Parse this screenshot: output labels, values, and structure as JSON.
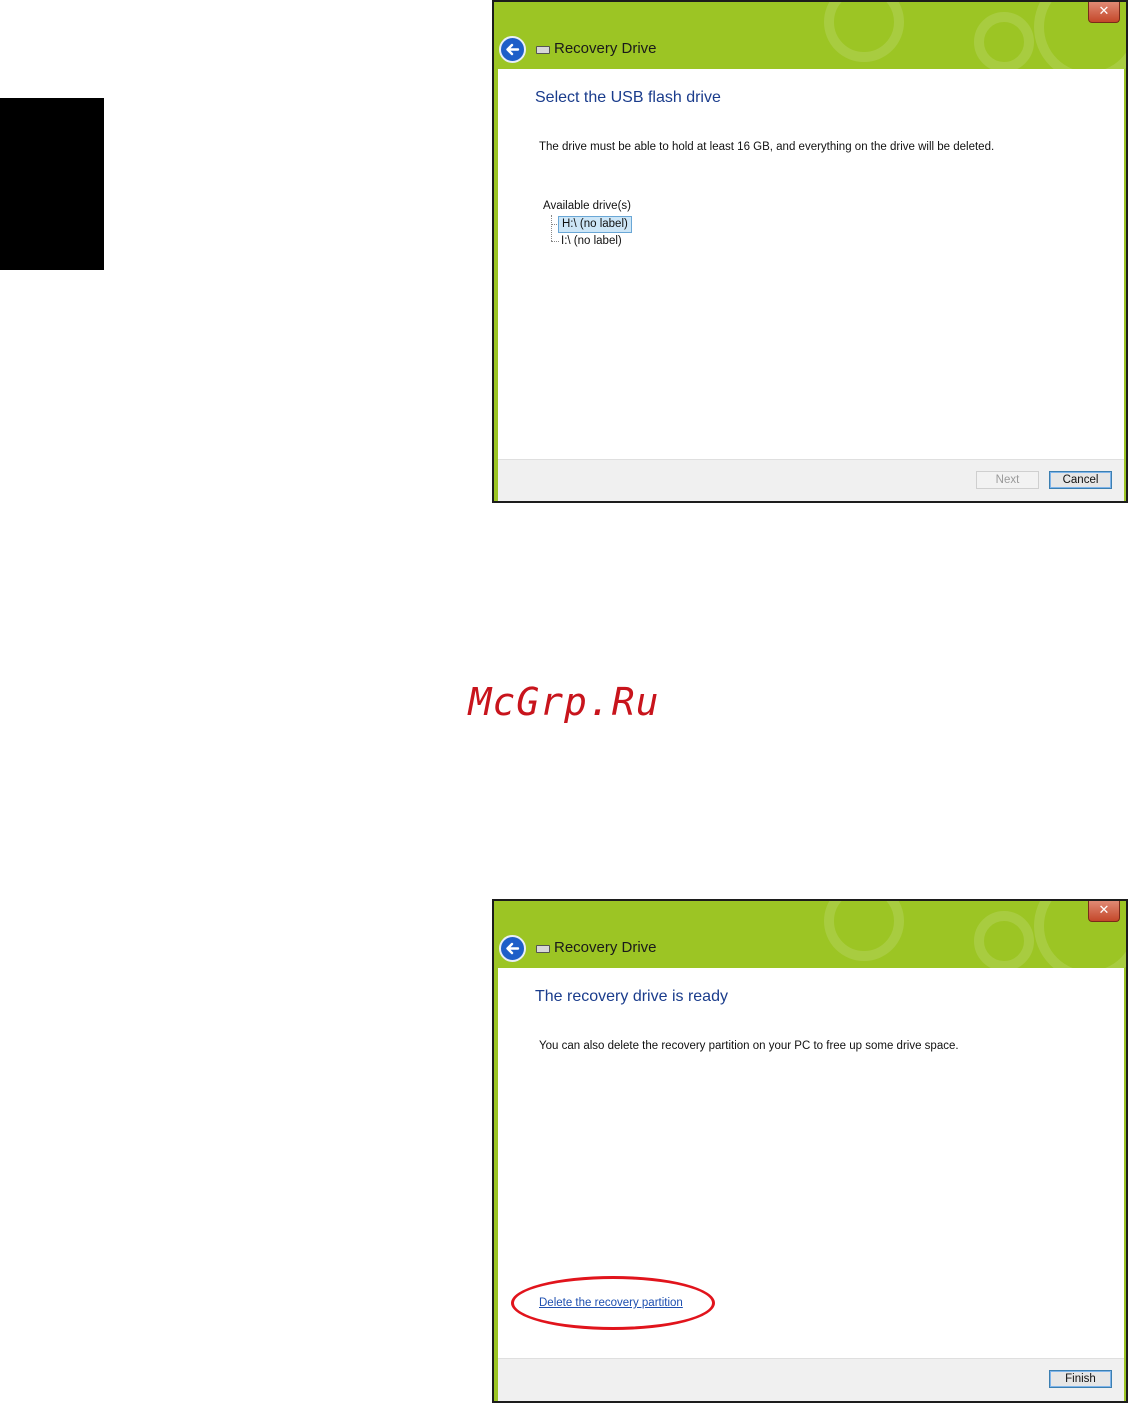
{
  "watermark": "McGrp.Ru",
  "watermark_color": "#c8141c",
  "window1": {
    "title": "Recovery Drive",
    "close": "✕",
    "heading": "Select the USB flash drive",
    "description": "The drive must be able to hold at least 16 GB, and everything on the drive will be deleted.",
    "tree_label": "Available drive(s)",
    "drives": [
      {
        "label": "H:\\ (no label)",
        "selected": true
      },
      {
        "label": "I:\\ (no label)",
        "selected": false
      }
    ],
    "next_label": "Next",
    "cancel_label": "Cancel"
  },
  "window2": {
    "title": "Recovery Drive",
    "close": "✕",
    "heading": "The recovery drive is ready",
    "description": "You can also delete the recovery partition on your PC to free up some drive space.",
    "delete_link": "Delete the recovery partition",
    "finish_label": "Finish"
  },
  "colors": {
    "title_green": "#9cc524",
    "heading_blue": "#1a3c8c",
    "link_blue": "#1e4fb0",
    "highlight_red": "#e1141c"
  }
}
